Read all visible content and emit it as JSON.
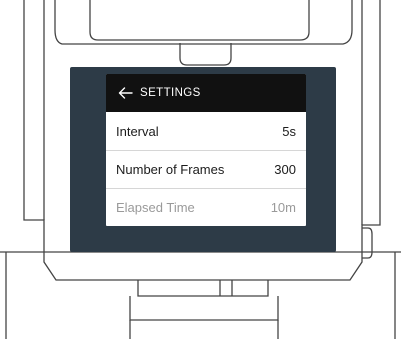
{
  "settings": {
    "title": "SETTINGS",
    "back_icon": "arrow-left-icon",
    "rows": [
      {
        "label": "Interval",
        "value": "5s",
        "enabled": true
      },
      {
        "label": "Number of Frames",
        "value": "300",
        "enabled": true
      },
      {
        "label": "Elapsed Time",
        "value": "10m",
        "enabled": false
      }
    ]
  },
  "colors": {
    "screen_bezel": "#2d3b47",
    "header_background": "#111111",
    "outline": "#444444",
    "disabled_text": "#9a9a9a"
  }
}
